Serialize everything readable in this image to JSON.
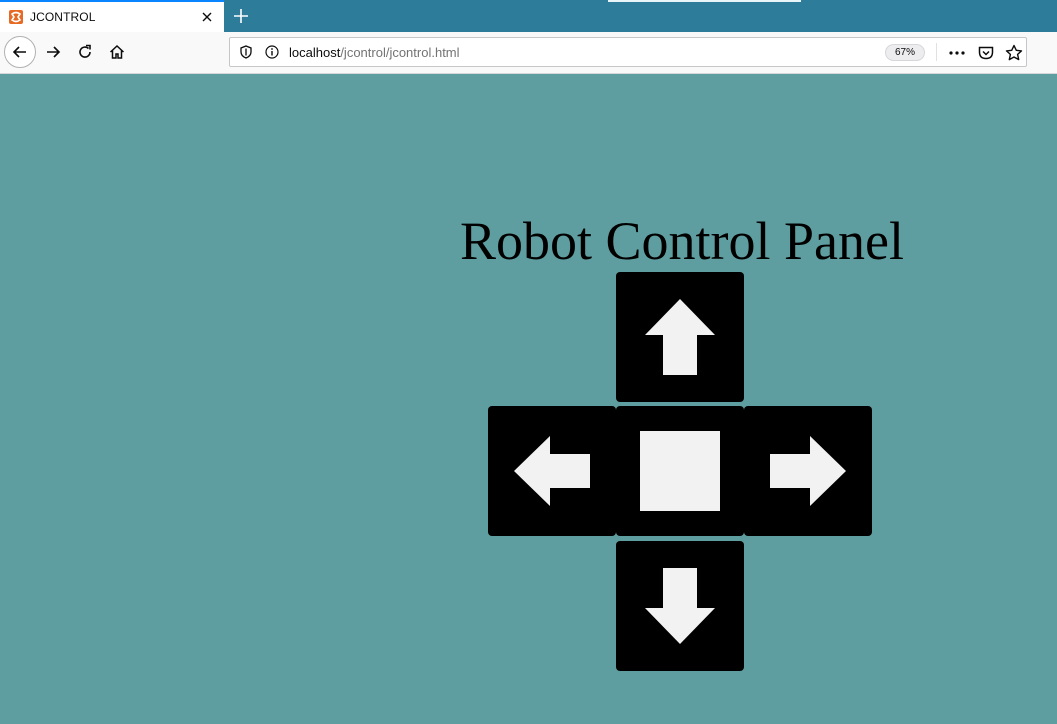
{
  "browser": {
    "tab": {
      "title": "JCONTROL"
    },
    "url": {
      "host": "localhost",
      "path": "/jcontrol/jcontrol.html"
    },
    "zoom": "67%"
  },
  "page": {
    "background": "#5f9ea0",
    "title": "Robot Control Panel",
    "controls": [
      {
        "id": "up",
        "icon": "arrow-up-icon"
      },
      {
        "id": "left",
        "icon": "arrow-left-icon"
      },
      {
        "id": "stop",
        "icon": "stop-square-icon"
      },
      {
        "id": "right",
        "icon": "arrow-right-icon"
      },
      {
        "id": "down",
        "icon": "arrow-down-icon"
      }
    ],
    "button_color": "#000000",
    "icon_color": "#f2f2f2"
  }
}
